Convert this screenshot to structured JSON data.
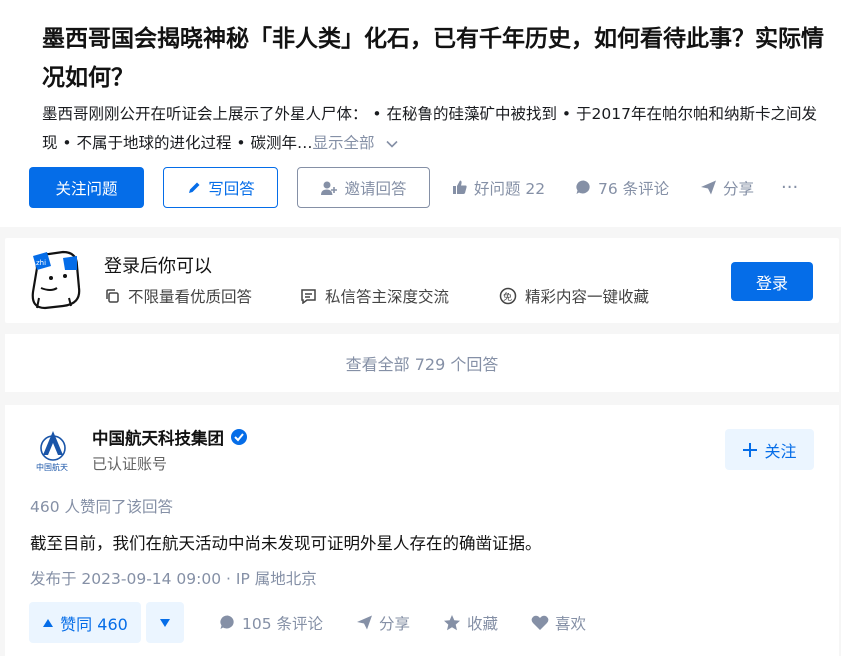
{
  "question": {
    "title": "墨西哥国会揭晓神秘「非人类」化石，已有千年历史，如何看待此事？实际情况如何？",
    "description": "墨西哥刚刚公开在听证会上展示了外星人尸体：  • 在秘鲁的硅藻矿中被找到 • 于2017年在帕尔帕和纳斯卡之间发现 • 不属于地球的进化过程 • 碳测年…",
    "show_all": "显示全部",
    "follow_label": "关注问题",
    "write_label": "写回答",
    "invite_label": "邀请回答",
    "good_question": "好问题 22",
    "comments": "76 条评论",
    "share": "分享",
    "more": "···"
  },
  "login_prompt": {
    "title": "登录后你可以",
    "perks": [
      "不限量看优质回答",
      "私信答主深度交流",
      "精彩内容一键收藏"
    ],
    "login_label": "登录"
  },
  "view_all": "查看全部 729 个回答",
  "answer": {
    "logo_text": "中国航天",
    "author": "中国航天科技集团",
    "author_sub": "已认证账号",
    "follow_label": "关注",
    "votes_text": "460 人赞同了该回答",
    "content": "截至目前，我们在航天活动中尚未发现可证明外星人存在的确凿证据。",
    "published": "发布于 2023-09-14 09:00 · IP 属地北京",
    "upvote_label": "赞同 460",
    "comments": "105 条评论",
    "share": "分享",
    "collect": "收藏",
    "like": "喜欢"
  },
  "colors": {
    "brand": "#056de8",
    "muted": "#8590a6",
    "light_blue": "#ebf5ff"
  }
}
